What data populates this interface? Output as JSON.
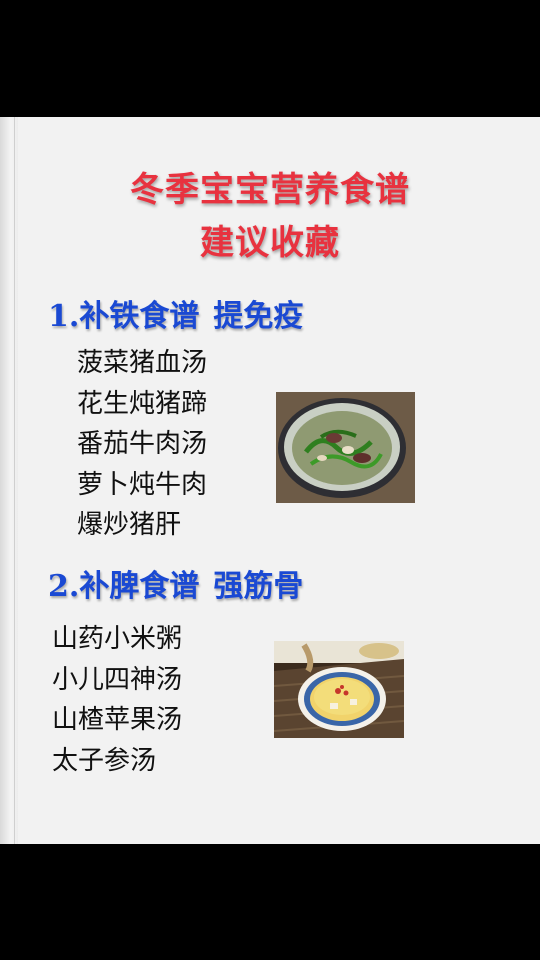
{
  "title": {
    "line1": "冬季宝宝营养食谱",
    "line2": "建议收藏"
  },
  "sections": [
    {
      "number": "1.",
      "heading_a": "补铁食谱",
      "heading_b": "提免疫",
      "items": [
        "菠菜猪血汤",
        "花生炖猪蹄",
        "番茄牛肉汤",
        "萝卜炖牛肉",
        "爆炒猪肝"
      ]
    },
    {
      "number": "2.",
      "heading_a": "补脾食谱",
      "heading_b": "强筋骨",
      "items": [
        "山药小米粥",
        "小儿四神汤",
        "山楂苹果汤",
        "太子参汤"
      ]
    }
  ],
  "colors": {
    "title": "#e8323f",
    "section": "#1a49d3",
    "text": "#111111",
    "paper": "#f2f2f2"
  }
}
